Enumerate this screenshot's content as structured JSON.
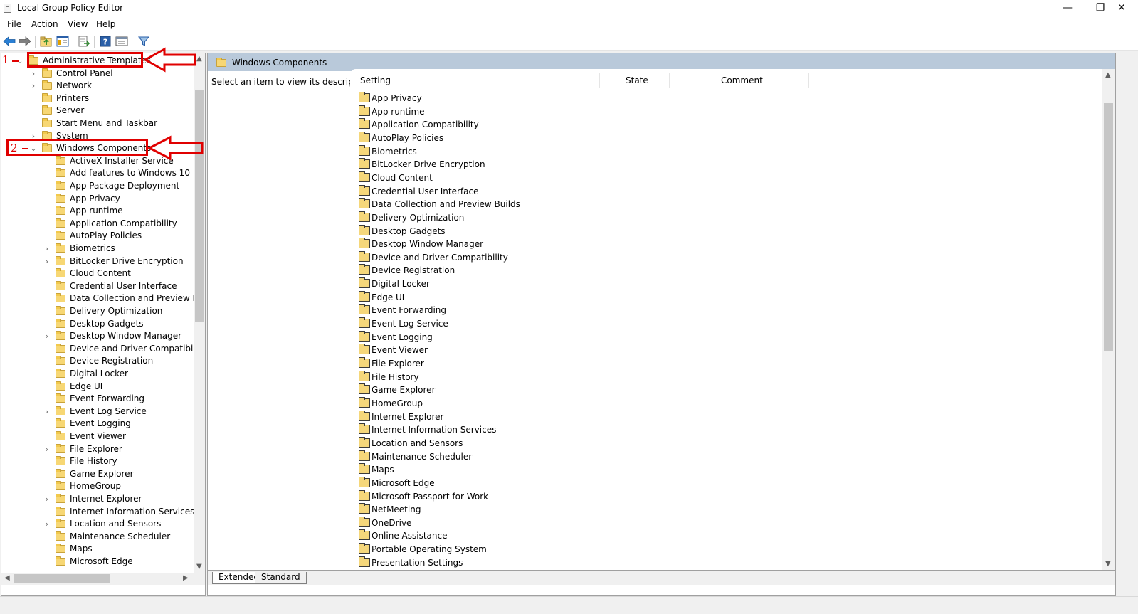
{
  "window": {
    "title": "Local Group Policy Editor",
    "minimize_glyph": "—",
    "restore_glyph": "❐",
    "close_glyph": "✕"
  },
  "menu": [
    "File",
    "Action",
    "View",
    "Help"
  ],
  "toolbar": {
    "icons": [
      "back-arrow-icon",
      "forward-arrow-icon",
      "up-folder-icon",
      "show-hide-tree-icon",
      "export-list-icon",
      "help-icon",
      "properties-icon",
      "filter-icon"
    ]
  },
  "annotations": {
    "first": "1",
    "second": "2",
    "color": "#e00000"
  },
  "tree": {
    "items": [
      {
        "label": "Administrative Templates",
        "expander": "expanded"
      },
      {
        "label": "Control Panel",
        "expander": "collapsed"
      },
      {
        "label": "Network",
        "expander": "collapsed"
      },
      {
        "label": "Printers",
        "expander": "none"
      },
      {
        "label": "Server",
        "expander": "none"
      },
      {
        "label": "Start Menu and Taskbar",
        "expander": "none"
      },
      {
        "label": "System",
        "expander": "collapsed"
      },
      {
        "label": "Windows Components",
        "expander": "expanded"
      },
      {
        "label": "ActiveX Installer Service",
        "expander": "none"
      },
      {
        "label": "Add features to Windows 10",
        "expander": "none"
      },
      {
        "label": "App Package Deployment",
        "expander": "none"
      },
      {
        "label": "App Privacy",
        "expander": "none"
      },
      {
        "label": "App runtime",
        "expander": "none"
      },
      {
        "label": "Application Compatibility",
        "expander": "none"
      },
      {
        "label": "AutoPlay Policies",
        "expander": "none"
      },
      {
        "label": "Biometrics",
        "expander": "collapsed"
      },
      {
        "label": "BitLocker Drive Encryption",
        "expander": "collapsed"
      },
      {
        "label": "Cloud Content",
        "expander": "none"
      },
      {
        "label": "Credential User Interface",
        "expander": "none"
      },
      {
        "label": "Data Collection and Preview Buil",
        "expander": "none"
      },
      {
        "label": "Delivery Optimization",
        "expander": "none"
      },
      {
        "label": "Desktop Gadgets",
        "expander": "none"
      },
      {
        "label": "Desktop Window Manager",
        "expander": "collapsed"
      },
      {
        "label": "Device and Driver Compatibility",
        "expander": "none"
      },
      {
        "label": "Device Registration",
        "expander": "none"
      },
      {
        "label": "Digital Locker",
        "expander": "none"
      },
      {
        "label": "Edge UI",
        "expander": "none"
      },
      {
        "label": "Event Forwarding",
        "expander": "none"
      },
      {
        "label": "Event Log Service",
        "expander": "collapsed"
      },
      {
        "label": "Event Logging",
        "expander": "none"
      },
      {
        "label": "Event Viewer",
        "expander": "none"
      },
      {
        "label": "File Explorer",
        "expander": "collapsed"
      },
      {
        "label": "File History",
        "expander": "none"
      },
      {
        "label": "Game Explorer",
        "expander": "none"
      },
      {
        "label": "HomeGroup",
        "expander": "none"
      },
      {
        "label": "Internet Explorer",
        "expander": "collapsed"
      },
      {
        "label": "Internet Information Services",
        "expander": "none"
      },
      {
        "label": "Location and Sensors",
        "expander": "collapsed"
      },
      {
        "label": "Maintenance Scheduler",
        "expander": "none"
      },
      {
        "label": "Maps",
        "expander": "none"
      },
      {
        "label": "Microsoft Edge",
        "expander": "none"
      }
    ]
  },
  "details": {
    "header": "Windows Components",
    "description": "Select an item to view its description.",
    "columns": [
      "Setting",
      "State",
      "Comment"
    ],
    "rows": [
      "App Privacy",
      "App runtime",
      "Application Compatibility",
      "AutoPlay Policies",
      "Biometrics",
      "BitLocker Drive Encryption",
      "Cloud Content",
      "Credential User Interface",
      "Data Collection and Preview Builds",
      "Delivery Optimization",
      "Desktop Gadgets",
      "Desktop Window Manager",
      "Device and Driver Compatibility",
      "Device Registration",
      "Digital Locker",
      "Edge UI",
      "Event Forwarding",
      "Event Log Service",
      "Event Logging",
      "Event Viewer",
      "File Explorer",
      "File History",
      "Game Explorer",
      "HomeGroup",
      "Internet Explorer",
      "Internet Information Services",
      "Location and Sensors",
      "Maintenance Scheduler",
      "Maps",
      "Microsoft Edge",
      "Microsoft Passport for Work",
      "NetMeeting",
      "OneDrive",
      "Online Assistance",
      "Portable Operating System",
      "Presentation Settings"
    ],
    "tabs": [
      "Extended",
      "Standard"
    ]
  }
}
